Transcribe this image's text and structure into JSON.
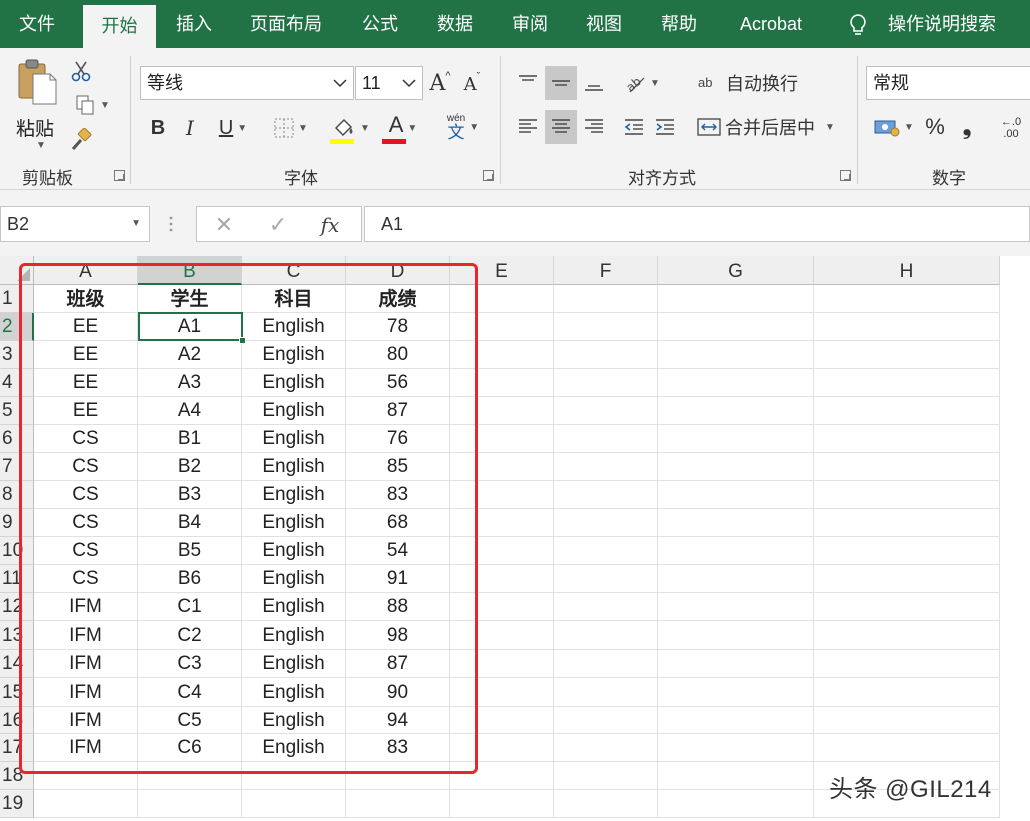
{
  "tabs": [
    "文件",
    "开始",
    "插入",
    "页面布局",
    "公式",
    "数据",
    "审阅",
    "视图",
    "帮助",
    "Acrobat",
    "操作说明搜索"
  ],
  "ribbon": {
    "clipboard": {
      "paste_label": "粘贴",
      "group_label": "剪贴板"
    },
    "font": {
      "font_name": "等线",
      "font_size": "11",
      "grow_label": "A",
      "shrink_label": "A",
      "bold_label": "B",
      "italic_label": "I",
      "underline_label": "U",
      "font_color_label": "A",
      "phonetic_top": "wén",
      "phonetic_bottom": "文",
      "group_label": "字体",
      "highlight_color": "#ffff00",
      "font_color": "#e81123"
    },
    "alignment": {
      "wrap_label": "自动换行",
      "wrap_icon_text": "ab",
      "merge_label": "合并后居中",
      "group_label": "对齐方式"
    },
    "number": {
      "format": "常规",
      "percent_label": "%",
      "comma_label": "❟",
      "decimal_top": "←.0",
      "decimal_bottom": ".00",
      "group_label": "数字"
    }
  },
  "formula_bar": {
    "name_box": "B2",
    "cancel_label": "✕",
    "enter_label": "✓",
    "fx_label": "fx",
    "value": "A1"
  },
  "grid": {
    "columns": [
      "A",
      "B",
      "C",
      "D",
      "E",
      "F",
      "G",
      "H"
    ],
    "selected_column": "B",
    "selected_row": "2",
    "rows": [
      {
        "n": "1",
        "cells": [
          "班级",
          "学生",
          "科目",
          "成绩"
        ]
      },
      {
        "n": "2",
        "cells": [
          "EE",
          "A1",
          "English",
          "78"
        ]
      },
      {
        "n": "3",
        "cells": [
          "EE",
          "A2",
          "English",
          "80"
        ]
      },
      {
        "n": "4",
        "cells": [
          "EE",
          "A3",
          "English",
          "56"
        ]
      },
      {
        "n": "5",
        "cells": [
          "EE",
          "A4",
          "English",
          "87"
        ]
      },
      {
        "n": "6",
        "cells": [
          "CS",
          "B1",
          "English",
          "76"
        ]
      },
      {
        "n": "7",
        "cells": [
          "CS",
          "B2",
          "English",
          "85"
        ]
      },
      {
        "n": "8",
        "cells": [
          "CS",
          "B3",
          "English",
          "83"
        ]
      },
      {
        "n": "9",
        "cells": [
          "CS",
          "B4",
          "English",
          "68"
        ]
      },
      {
        "n": "10",
        "cells": [
          "CS",
          "B5",
          "English",
          "54"
        ]
      },
      {
        "n": "11",
        "cells": [
          "CS",
          "B6",
          "English",
          "91"
        ]
      },
      {
        "n": "12",
        "cells": [
          "IFM",
          "C1",
          "English",
          "88"
        ]
      },
      {
        "n": "13",
        "cells": [
          "IFM",
          "C2",
          "English",
          "98"
        ]
      },
      {
        "n": "14",
        "cells": [
          "IFM",
          "C3",
          "English",
          "87"
        ]
      },
      {
        "n": "15",
        "cells": [
          "IFM",
          "C4",
          "English",
          "90"
        ]
      },
      {
        "n": "16",
        "cells": [
          "IFM",
          "C5",
          "English",
          "94"
        ]
      },
      {
        "n": "17",
        "cells": [
          "IFM",
          "C6",
          "English",
          "83"
        ]
      },
      {
        "n": "18",
        "cells": [
          "",
          "",
          "",
          ""
        ]
      },
      {
        "n": "19",
        "cells": [
          "",
          "",
          "",
          ""
        ]
      }
    ]
  },
  "annotation_color": "#e8262c",
  "watermark": "头条 @GIL214"
}
